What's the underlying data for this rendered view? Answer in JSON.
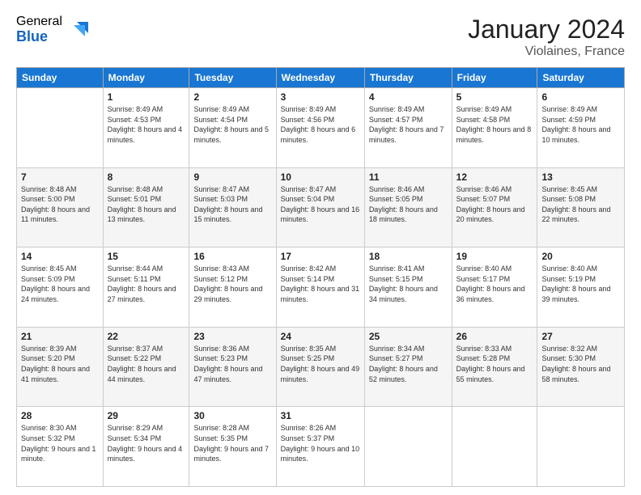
{
  "logo": {
    "general": "General",
    "blue": "Blue"
  },
  "header": {
    "month": "January 2024",
    "location": "Violaines, France"
  },
  "days_of_week": [
    "Sunday",
    "Monday",
    "Tuesday",
    "Wednesday",
    "Thursday",
    "Friday",
    "Saturday"
  ],
  "weeks": [
    [
      {
        "day": "",
        "info": ""
      },
      {
        "day": "1",
        "info": "Sunrise: 8:49 AM\nSunset: 4:53 PM\nDaylight: 8 hours\nand 4 minutes."
      },
      {
        "day": "2",
        "info": "Sunrise: 8:49 AM\nSunset: 4:54 PM\nDaylight: 8 hours\nand 5 minutes."
      },
      {
        "day": "3",
        "info": "Sunrise: 8:49 AM\nSunset: 4:56 PM\nDaylight: 8 hours\nand 6 minutes."
      },
      {
        "day": "4",
        "info": "Sunrise: 8:49 AM\nSunset: 4:57 PM\nDaylight: 8 hours\nand 7 minutes."
      },
      {
        "day": "5",
        "info": "Sunrise: 8:49 AM\nSunset: 4:58 PM\nDaylight: 8 hours\nand 8 minutes."
      },
      {
        "day": "6",
        "info": "Sunrise: 8:49 AM\nSunset: 4:59 PM\nDaylight: 8 hours\nand 10 minutes."
      }
    ],
    [
      {
        "day": "7",
        "info": "Sunrise: 8:48 AM\nSunset: 5:00 PM\nDaylight: 8 hours\nand 11 minutes."
      },
      {
        "day": "8",
        "info": "Sunrise: 8:48 AM\nSunset: 5:01 PM\nDaylight: 8 hours\nand 13 minutes."
      },
      {
        "day": "9",
        "info": "Sunrise: 8:47 AM\nSunset: 5:03 PM\nDaylight: 8 hours\nand 15 minutes."
      },
      {
        "day": "10",
        "info": "Sunrise: 8:47 AM\nSunset: 5:04 PM\nDaylight: 8 hours\nand 16 minutes."
      },
      {
        "day": "11",
        "info": "Sunrise: 8:46 AM\nSunset: 5:05 PM\nDaylight: 8 hours\nand 18 minutes."
      },
      {
        "day": "12",
        "info": "Sunrise: 8:46 AM\nSunset: 5:07 PM\nDaylight: 8 hours\nand 20 minutes."
      },
      {
        "day": "13",
        "info": "Sunrise: 8:45 AM\nSunset: 5:08 PM\nDaylight: 8 hours\nand 22 minutes."
      }
    ],
    [
      {
        "day": "14",
        "info": "Sunrise: 8:45 AM\nSunset: 5:09 PM\nDaylight: 8 hours\nand 24 minutes."
      },
      {
        "day": "15",
        "info": "Sunrise: 8:44 AM\nSunset: 5:11 PM\nDaylight: 8 hours\nand 27 minutes."
      },
      {
        "day": "16",
        "info": "Sunrise: 8:43 AM\nSunset: 5:12 PM\nDaylight: 8 hours\nand 29 minutes."
      },
      {
        "day": "17",
        "info": "Sunrise: 8:42 AM\nSunset: 5:14 PM\nDaylight: 8 hours\nand 31 minutes."
      },
      {
        "day": "18",
        "info": "Sunrise: 8:41 AM\nSunset: 5:15 PM\nDaylight: 8 hours\nand 34 minutes."
      },
      {
        "day": "19",
        "info": "Sunrise: 8:40 AM\nSunset: 5:17 PM\nDaylight: 8 hours\nand 36 minutes."
      },
      {
        "day": "20",
        "info": "Sunrise: 8:40 AM\nSunset: 5:19 PM\nDaylight: 8 hours\nand 39 minutes."
      }
    ],
    [
      {
        "day": "21",
        "info": "Sunrise: 8:39 AM\nSunset: 5:20 PM\nDaylight: 8 hours\nand 41 minutes."
      },
      {
        "day": "22",
        "info": "Sunrise: 8:37 AM\nSunset: 5:22 PM\nDaylight: 8 hours\nand 44 minutes."
      },
      {
        "day": "23",
        "info": "Sunrise: 8:36 AM\nSunset: 5:23 PM\nDaylight: 8 hours\nand 47 minutes."
      },
      {
        "day": "24",
        "info": "Sunrise: 8:35 AM\nSunset: 5:25 PM\nDaylight: 8 hours\nand 49 minutes."
      },
      {
        "day": "25",
        "info": "Sunrise: 8:34 AM\nSunset: 5:27 PM\nDaylight: 8 hours\nand 52 minutes."
      },
      {
        "day": "26",
        "info": "Sunrise: 8:33 AM\nSunset: 5:28 PM\nDaylight: 8 hours\nand 55 minutes."
      },
      {
        "day": "27",
        "info": "Sunrise: 8:32 AM\nSunset: 5:30 PM\nDaylight: 8 hours\nand 58 minutes."
      }
    ],
    [
      {
        "day": "28",
        "info": "Sunrise: 8:30 AM\nSunset: 5:32 PM\nDaylight: 9 hours\nand 1 minute."
      },
      {
        "day": "29",
        "info": "Sunrise: 8:29 AM\nSunset: 5:34 PM\nDaylight: 9 hours\nand 4 minutes."
      },
      {
        "day": "30",
        "info": "Sunrise: 8:28 AM\nSunset: 5:35 PM\nDaylight: 9 hours\nand 7 minutes."
      },
      {
        "day": "31",
        "info": "Sunrise: 8:26 AM\nSunset: 5:37 PM\nDaylight: 9 hours\nand 10 minutes."
      },
      {
        "day": "",
        "info": ""
      },
      {
        "day": "",
        "info": ""
      },
      {
        "day": "",
        "info": ""
      }
    ]
  ]
}
